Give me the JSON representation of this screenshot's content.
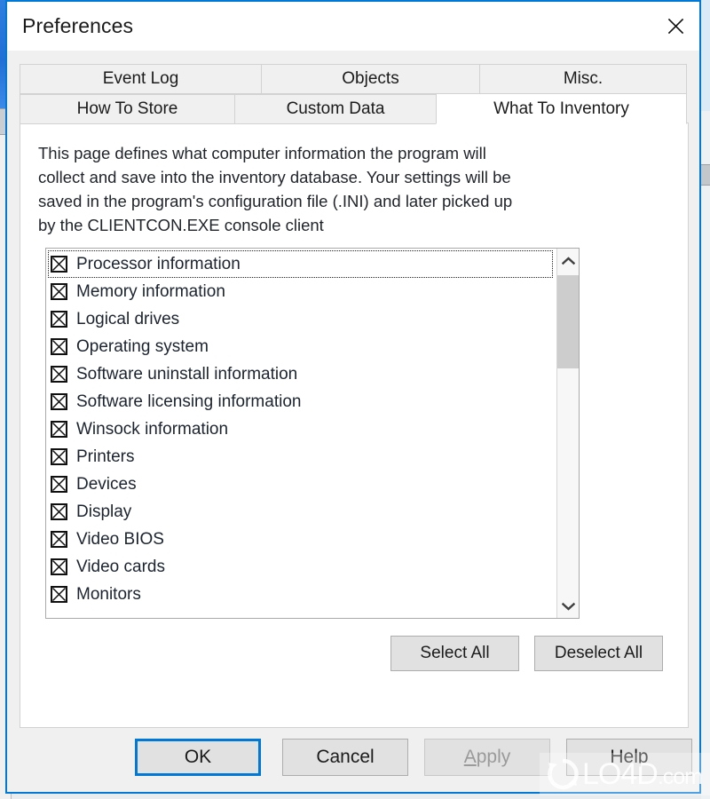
{
  "window": {
    "title": "Preferences",
    "close_icon": "close-icon",
    "accent_color": "#0078d7",
    "titlebar_bg": "#ffffff",
    "dialog_bg": "#f0f0f0"
  },
  "tabs": {
    "row1": [
      {
        "label": "Event Log",
        "selected": false
      },
      {
        "label": "Objects",
        "selected": false
      },
      {
        "label": "Misc.",
        "selected": false
      }
    ],
    "row2": [
      {
        "label": "How To Store",
        "selected": false
      },
      {
        "label": "Custom Data",
        "selected": false
      },
      {
        "label": "What To Inventory",
        "selected": true
      }
    ]
  },
  "panel": {
    "description": "This page defines what computer information the program will\ncollect and save into the inventory database. Your settings will be\nsaved in the program's configuration file (.INI) and later picked up\nby the CLIENTCON.EXE console client"
  },
  "inventory_list": {
    "items": [
      {
        "label": "Processor information",
        "checked": true,
        "focused": true
      },
      {
        "label": "Memory information",
        "checked": true,
        "focused": false
      },
      {
        "label": "Logical drives",
        "checked": true,
        "focused": false
      },
      {
        "label": "Operating system",
        "checked": true,
        "focused": false
      },
      {
        "label": "Software uninstall information",
        "checked": true,
        "focused": false
      },
      {
        "label": "Software licensing information",
        "checked": true,
        "focused": false
      },
      {
        "label": "Winsock information",
        "checked": true,
        "focused": false
      },
      {
        "label": "Printers",
        "checked": true,
        "focused": false
      },
      {
        "label": "Devices",
        "checked": true,
        "focused": false
      },
      {
        "label": "Display",
        "checked": true,
        "focused": false
      },
      {
        "label": "Video BIOS",
        "checked": true,
        "focused": false
      },
      {
        "label": "Video cards",
        "checked": true,
        "focused": false
      },
      {
        "label": "Monitors",
        "checked": true,
        "focused": false
      }
    ],
    "scrollbar": {
      "up_icon": "chevron-up-icon",
      "down_icon": "chevron-down-icon",
      "thumb_color": "#cdcdcd"
    }
  },
  "list_actions": {
    "select_all": "Select All",
    "deselect_all": "Deselect All"
  },
  "footer": {
    "ok": "OK",
    "cancel": "Cancel",
    "apply": "Apply",
    "apply_accel": "A",
    "apply_rest": "pply",
    "apply_disabled": true,
    "help": "Help"
  },
  "watermark": {
    "text": "LO4D",
    "suffix": ".com",
    "logo_icon": "refresh-circle-icon"
  }
}
